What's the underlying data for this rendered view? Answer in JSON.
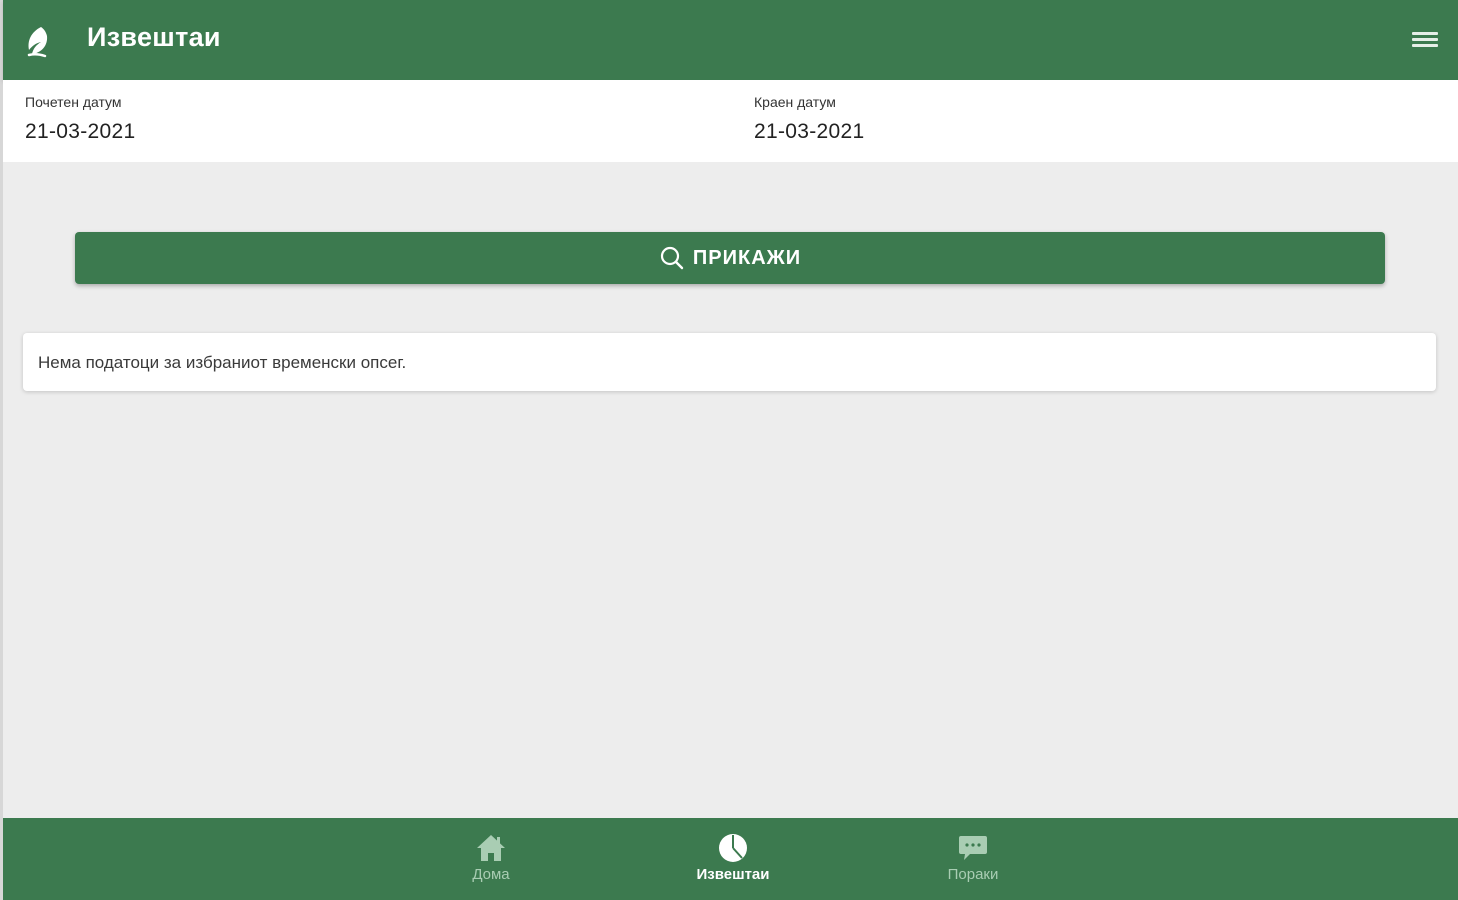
{
  "header": {
    "title": "Извештаи",
    "logo_icon": "leaf-logo-icon",
    "menu_icon": "hamburger-menu-icon",
    "color": "#3c7a4f"
  },
  "date_range": {
    "start_label": "Почетен датум",
    "start_value": "21-03-2021",
    "end_label": "Краен датум",
    "end_value": "21-03-2021"
  },
  "actions": {
    "show_label": "ПРИКАЖИ",
    "show_icon": "search-icon"
  },
  "message": {
    "text": "Нема податоци за избраниот временски опсег."
  },
  "bottom_nav": {
    "active": "reports",
    "items": [
      {
        "key": "home",
        "label": "Дома",
        "icon": "home-icon"
      },
      {
        "key": "reports",
        "label": "Извештаи",
        "icon": "pie-chart-icon"
      },
      {
        "key": "messages",
        "label": "Пораки",
        "icon": "chat-bubble-icon"
      }
    ]
  }
}
